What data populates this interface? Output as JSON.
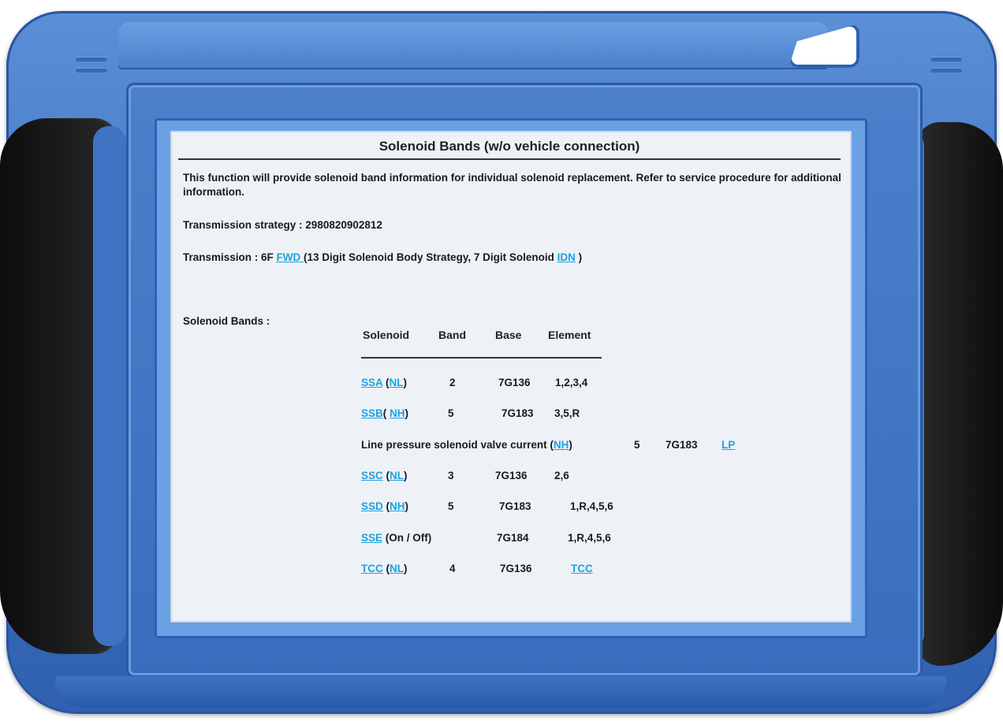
{
  "page": {
    "title": "Solenoid Bands (w/o vehicle connection)",
    "description": "This function will provide solenoid band information for individual solenoid replacement. Refer to service procedure for additional information.",
    "strategy_label": "Transmission strategy : 2980820902812",
    "transmission": {
      "prefix": "Transmission : 6F ",
      "fwd_link": "FWD ",
      "middle": " (13   Digit Solenoid Body Strategy, 7  Digit Solenoid ",
      "idn_link": "IDN",
      "suffix": " )"
    },
    "bands_label": "Solenoid Bands :"
  },
  "table": {
    "headers": [
      "Solenoid",
      "Band",
      "Base",
      "Element"
    ],
    "rows": [
      {
        "solenoid": "SSA",
        "pre": " (",
        "mode": "NL",
        "post": ")",
        "band": "2",
        "base": "7G136",
        "element": "1,2,3,4"
      },
      {
        "solenoid": "SSB",
        "pre": "( ",
        "mode": "NH",
        "post": ")",
        "band": "5",
        "base": "7G183",
        "element": "3,5,R"
      },
      {
        "solenoid": "Line pressure solenoid valve current",
        "pre": " (",
        "mode": "NH",
        "post": ")",
        "band": "5",
        "base": "7G183",
        "element": "LP"
      },
      {
        "solenoid": "SSC",
        "pre": " (",
        "mode": "NL",
        "post": ")",
        "band": "3",
        "base": "7G136",
        "element": "2,6"
      },
      {
        "solenoid": "SSD",
        "pre": " (",
        "mode": "NH",
        "post": ")",
        "band": "5",
        "base": "7G183",
        "element": "1,R,4,5,6"
      },
      {
        "solenoid": "SSE",
        "pre": " (On / Off)",
        "mode": "",
        "post": "",
        "band": "",
        "base": "7G184",
        "element": "1,R,4,5,6"
      },
      {
        "solenoid": "TCC",
        "pre": " (",
        "mode": "NL",
        "post": ")",
        "band": "4",
        "base": "7G136",
        "element": "TCC "
      }
    ]
  },
  "colors": {
    "link": "#1aa3e0",
    "device_blue": "#3f74c4",
    "screen_bg": "#eef2f7"
  }
}
